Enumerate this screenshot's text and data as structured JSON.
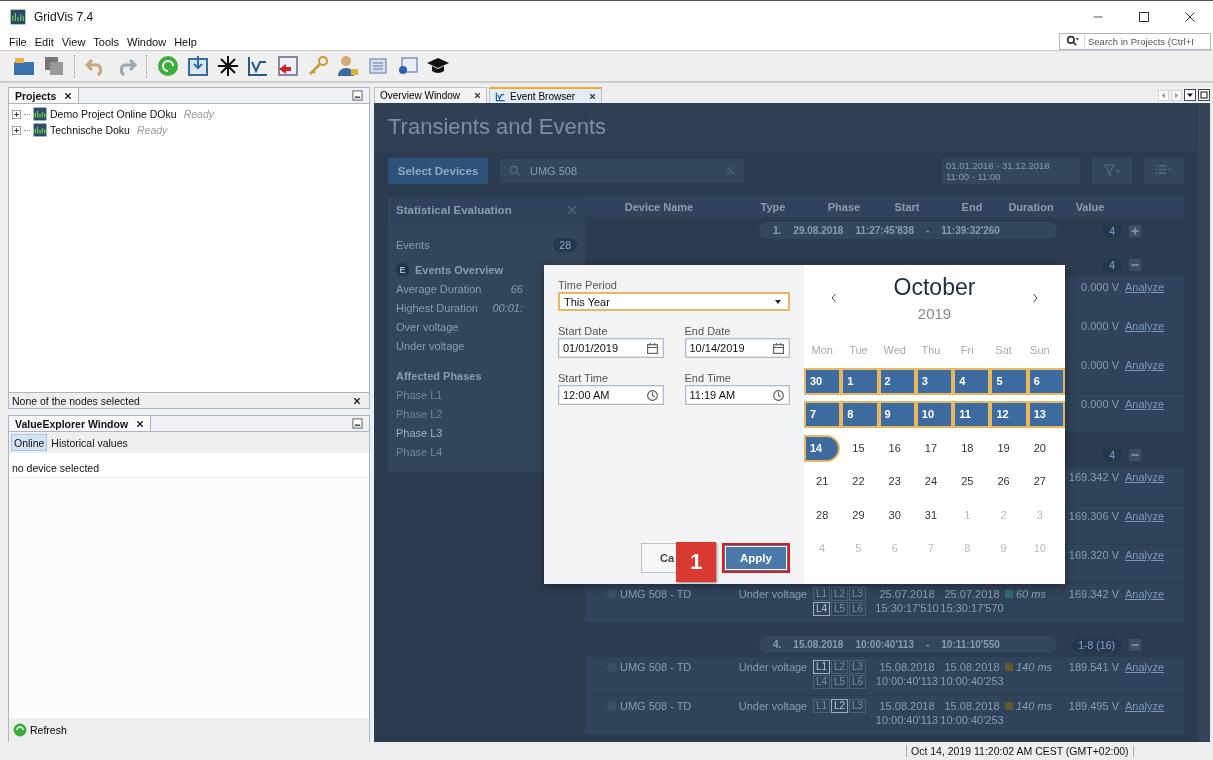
{
  "window": {
    "title": "GridVis 7.4"
  },
  "menu": [
    "File",
    "Edit",
    "View",
    "Tools",
    "Window",
    "Help"
  ],
  "search": {
    "placeholder": "Search in Projects (Ctrl+I"
  },
  "projects": {
    "title": "Projects",
    "items": [
      {
        "name": "Demo Project Online DOku",
        "status": "Ready",
        "expanded": false
      },
      {
        "name": "Technische Doku",
        "status": "Ready",
        "expanded": false
      }
    ]
  },
  "node_status": "None of the nodes selected",
  "value_explorer": {
    "title": "ValueExplorer Window",
    "tabs": [
      {
        "label": "Online",
        "selected": true
      },
      {
        "label": "Historical values",
        "selected": false
      }
    ],
    "message": "no device selected",
    "refresh": "Refresh"
  },
  "editor_tabs": [
    {
      "label": "Overview Window",
      "selected": false
    },
    {
      "label": "Event Browser",
      "selected": true
    }
  ],
  "event_browser": {
    "title": "Transients and Events",
    "select_devices": "Select Devices",
    "search_value": "UMG 508",
    "date_range": "01.01.2018 - 31.12.2018",
    "time_range": "11:00 - 11:00",
    "stats": {
      "title": "Statistical Evaluation",
      "events_label": "Events",
      "events_count": "28",
      "overview_badge": "E",
      "overview_title": "Events Overview",
      "rows": [
        {
          "label": "Average Duration",
          "value": "66"
        },
        {
          "label": "Highest Duration",
          "value": "00:01:"
        },
        {
          "label": "Over voltage"
        },
        {
          "label": "Under voltage"
        }
      ],
      "phases_title": "Affected Phases",
      "phases": [
        {
          "label": "Phase L1",
          "active": false
        },
        {
          "label": "Phase L2",
          "active": false
        },
        {
          "label": "Phase L3",
          "active": true
        },
        {
          "label": "Phase L4",
          "active": false
        }
      ]
    },
    "table": {
      "columns": [
        "Device Name",
        "Type",
        "Phase",
        "Start",
        "End",
        "Duration",
        "Value"
      ],
      "items": [
        {
          "kind": "group",
          "index": "1.",
          "date": "29.08.2018",
          "start": "11:27:45'838",
          "dash": "-",
          "end": "11:39:32'260",
          "count": "4",
          "expanded": false
        },
        {
          "kind": "group",
          "count": "4",
          "expanded": true
        },
        {
          "kind": "row",
          "value": "0.000 V",
          "action": "Analyze"
        },
        {
          "kind": "row",
          "value": "0.000 V",
          "action": "Analyze"
        },
        {
          "kind": "row",
          "value": "0.000 V",
          "action": "Analyze"
        },
        {
          "kind": "row",
          "value": "0.000 V",
          "action": "Analyze"
        },
        {
          "kind": "group",
          "count": "4",
          "expanded": true
        },
        {
          "kind": "row",
          "value": "169.342 V",
          "action": "Analyze"
        },
        {
          "kind": "row",
          "value": "169.306 V",
          "action": "Analyze"
        },
        {
          "kind": "row",
          "value": "169.320 V",
          "action": "Analyze"
        },
        {
          "kind": "row",
          "device": "UMG 508 - TD",
          "type": "Under voltage",
          "phases": [
            {
              "label": "L1",
              "selected": false
            },
            {
              "label": "L2",
              "selected": false
            },
            {
              "label": "L3",
              "selected": false
            },
            {
              "label": "L4",
              "selected": true
            },
            {
              "label": "L5",
              "selected": false
            },
            {
              "label": "L6",
              "selected": false
            }
          ],
          "start_date": "25.07.2018",
          "start_time": "15:30:17'510",
          "end_date": "25.07.2018",
          "end_time": "15:30:17'570",
          "duration": "60 ms",
          "color": "#2f6b6b",
          "value": "169.342 V",
          "action": "Analyze"
        },
        {
          "kind": "group",
          "index": "4.",
          "date": "15.08.2018",
          "start": "10:00:40'113",
          "dash": "-",
          "end": "10:11:10'550",
          "count": "1-8 (16)",
          "expanded": true
        },
        {
          "kind": "row",
          "device": "UMG 508 - TD",
          "type": "Under voltage",
          "phases": [
            {
              "label": "L1",
              "selected": true
            },
            {
              "label": "L2",
              "selected": false
            },
            {
              "label": "L3",
              "selected": false
            },
            {
              "label": "L4",
              "selected": false
            },
            {
              "label": "L5",
              "selected": false
            },
            {
              "label": "L6",
              "selected": false
            }
          ],
          "start_date": "15.08.2018",
          "start_time": "10:00:40'113",
          "end_date": "15.08.2018",
          "end_time": "10:00:40'253",
          "duration": "140 ms",
          "color": "#5e5a2e",
          "value": "189.541 V",
          "action": "Analyze"
        },
        {
          "kind": "row",
          "device": "UMG 508 - TD",
          "type": "Under voltage",
          "phases": [
            {
              "label": "L1",
              "selected": false
            },
            {
              "label": "L2",
              "selected": true
            },
            {
              "label": "L3",
              "selected": false
            }
          ],
          "start_date": "15.08.2018",
          "start_time": "10:00:40'113",
          "end_date": "15.08.2018",
          "end_time": "10:00:40'253",
          "duration": "140 ms",
          "color": "#5e5a2e",
          "value": "189.495 V",
          "action": "Analyze"
        }
      ]
    }
  },
  "dialog": {
    "time_period": {
      "label": "Time Period",
      "value": "This Year"
    },
    "start_date": {
      "label": "Start Date",
      "value": "01/01/2019"
    },
    "end_date": {
      "label": "End Date",
      "value": "10/14/2019"
    },
    "start_time": {
      "label": "Start Time",
      "value": "12:00 AM"
    },
    "end_time": {
      "label": "End Time",
      "value": "11:19 AM"
    },
    "cancel": "Ca",
    "apply": "Apply",
    "marker": "1",
    "calendar": {
      "month": "October",
      "year": "2019",
      "weekdays": [
        "Mon",
        "Tue",
        "Wed",
        "Thu",
        "Fri",
        "Sat",
        "Sun"
      ],
      "weeks": [
        [
          {
            "label": "30",
            "selected": true,
            "outside": false
          },
          {
            "label": "1",
            "selected": true,
            "outside": false
          },
          {
            "label": "2",
            "selected": true,
            "outside": false
          },
          {
            "label": "3",
            "selected": true,
            "outside": false
          },
          {
            "label": "4",
            "selected": true,
            "outside": false
          },
          {
            "label": "5",
            "selected": true,
            "outside": false
          },
          {
            "label": "6",
            "selected": true,
            "outside": false
          }
        ],
        [
          {
            "label": "7",
            "selected": true,
            "outside": false
          },
          {
            "label": "8",
            "selected": true,
            "outside": false
          },
          {
            "label": "9",
            "selected": true,
            "outside": false
          },
          {
            "label": "10",
            "selected": true,
            "outside": false
          },
          {
            "label": "11",
            "selected": true,
            "outside": false
          },
          {
            "label": "12",
            "selected": true,
            "outside": false
          },
          {
            "label": "13",
            "selected": true,
            "outside": false
          }
        ],
        [
          {
            "label": "14",
            "selected": true,
            "outside": false
          },
          {
            "label": "15",
            "selected": false,
            "outside": false
          },
          {
            "label": "16",
            "selected": false,
            "outside": false
          },
          {
            "label": "17",
            "selected": false,
            "outside": false
          },
          {
            "label": "18",
            "selected": false,
            "outside": false
          },
          {
            "label": "19",
            "selected": false,
            "outside": false
          },
          {
            "label": "20",
            "selected": false,
            "outside": false
          }
        ],
        [
          {
            "label": "21",
            "selected": false,
            "outside": false
          },
          {
            "label": "22",
            "selected": false,
            "outside": false
          },
          {
            "label": "23",
            "selected": false,
            "outside": false
          },
          {
            "label": "24",
            "selected": false,
            "outside": false
          },
          {
            "label": "25",
            "selected": false,
            "outside": false
          },
          {
            "label": "26",
            "selected": false,
            "outside": false
          },
          {
            "label": "27",
            "selected": false,
            "outside": false
          }
        ],
        [
          {
            "label": "28",
            "selected": false,
            "outside": false
          },
          {
            "label": "29",
            "selected": false,
            "outside": false
          },
          {
            "label": "30",
            "selected": false,
            "outside": false
          },
          {
            "label": "31",
            "selected": false,
            "outside": false
          },
          {
            "label": "1",
            "selected": false,
            "outside": true
          },
          {
            "label": "2",
            "selected": false,
            "outside": true
          },
          {
            "label": "3",
            "selected": false,
            "outside": true
          }
        ],
        [
          {
            "label": "4",
            "selected": false,
            "outside": true
          },
          {
            "label": "5",
            "selected": false,
            "outside": true
          },
          {
            "label": "6",
            "selected": false,
            "outside": true
          },
          {
            "label": "7",
            "selected": false,
            "outside": true
          },
          {
            "label": "8",
            "selected": false,
            "outside": true
          },
          {
            "label": "9",
            "selected": false,
            "outside": true
          },
          {
            "label": "10",
            "selected": false,
            "outside": true
          }
        ]
      ]
    }
  },
  "status_bar": "Oct 14, 2019 11:20:02 AM CEST (GMT+02:00)"
}
